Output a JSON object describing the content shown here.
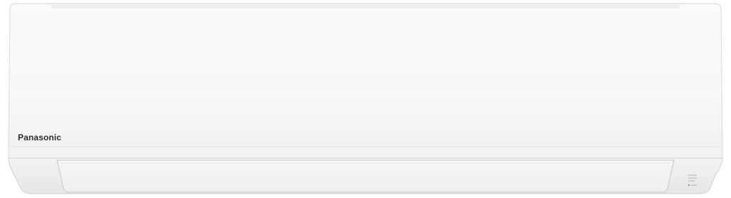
{
  "product": {
    "brand_label": "Panasonic",
    "type": "wall-mounted air conditioner indoor unit",
    "colors": {
      "body": "#f7f7f7",
      "panel_edge": "#d9d9d9",
      "brand_text": "#2e2e2e"
    }
  },
  "icons": {
    "status_indicator": "indicator-lines-icon"
  }
}
